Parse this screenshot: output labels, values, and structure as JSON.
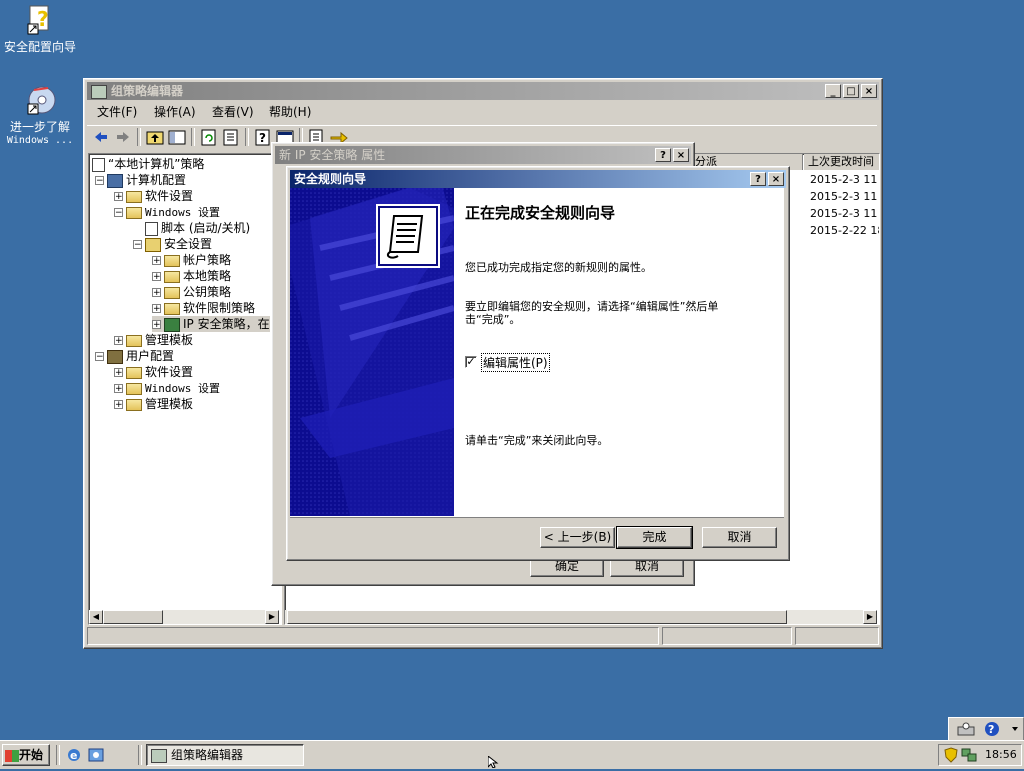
{
  "desktop": {
    "icons": [
      {
        "label": "安全配置向导",
        "icon": "security-wizard-icon"
      },
      {
        "label_line1": "进一步了解",
        "label_line2": "Windows ...",
        "icon": "cd-help-icon"
      }
    ]
  },
  "gpedit": {
    "title": "组策略编辑器",
    "menu": [
      "文件(F)",
      "操作(A)",
      "查看(V)",
      "帮助(H)"
    ],
    "tree": {
      "root": "“本地计算机”策略",
      "computer_config": "计算机配置",
      "software_settings": "软件设置",
      "windows_settings": "Windows 设置",
      "scripts": "脚本 (启动/关机)",
      "security_settings": "安全设置",
      "account_policies": "帐户策略",
      "local_policies": "本地策略",
      "public_key_policies": "公钥策略",
      "software_restriction": "软件限制策略",
      "ip_security": "IP 安全策略，在",
      "admin_templates": "管理模板",
      "user_config": "用户配置",
      "user_software_settings": "软件设置",
      "user_windows_settings": "Windows 设置",
      "user_admin_templates": "管理模板"
    },
    "list": {
      "col_assigned": "分派",
      "col_modified": "上次更改时间",
      "rows": [
        "2015-2-3 11",
        "2015-2-3 11",
        "2015-2-3 11",
        "2015-2-22 18"
      ]
    }
  },
  "props_dialog": {
    "title": "新 IP 安全策略 属性",
    "ok": "确定",
    "cancel": "取消"
  },
  "wizard": {
    "title": "安全规则向导",
    "heading": "正在完成安全规则向导",
    "para1": "您已成功完成指定您的新规则的属性。",
    "para2_line1": "要立即编辑您的安全规则，请选择“编辑属性”然后单",
    "para2_line2": "击“完成”。",
    "checkbox_label": "编辑属性(P)",
    "checkbox_checked": true,
    "para3": "请单击“完成”来关闭此向导。",
    "back": "< 上一步(B)",
    "finish": "完成",
    "cancel": "取消"
  },
  "taskbar": {
    "start": "开始",
    "task": "组策略编辑器",
    "clock": "18:56"
  }
}
